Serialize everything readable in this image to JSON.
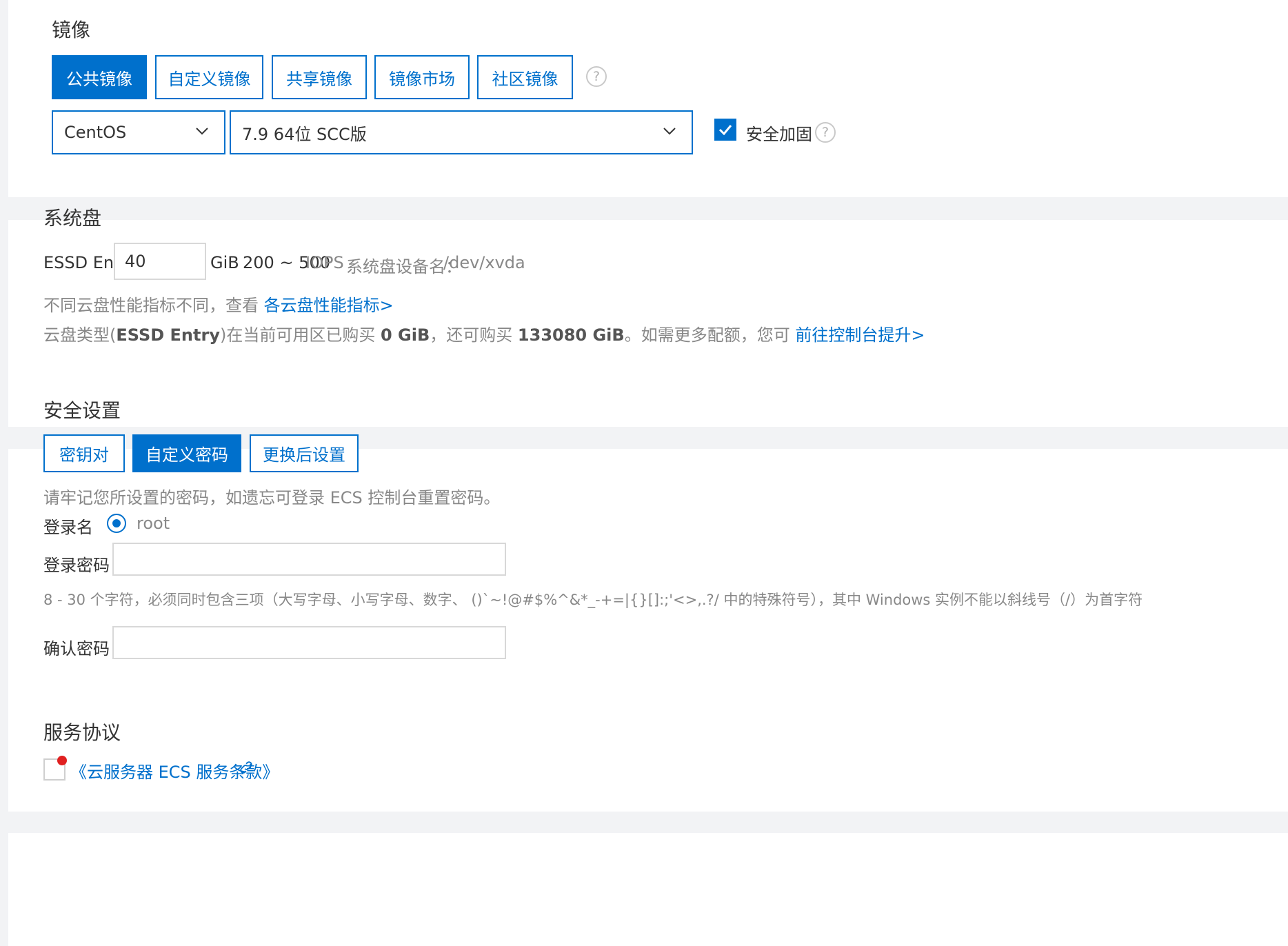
{
  "image_section": {
    "title": "镜像",
    "tabs": [
      "公共镜像",
      "自定义镜像",
      "共享镜像",
      "镜像市场",
      "社区镜像"
    ],
    "active_tab": "公共镜像",
    "os_select": "CentOS",
    "version_select": "7.9 64位 SCC版",
    "security_hardening_label": "安全加固",
    "security_hardening_checked": true
  },
  "disk_section": {
    "title": "系统盘",
    "disk_type": "ESSD Entry",
    "size_value": "40",
    "unit": "GiB",
    "iops_range": "200 ~ 500",
    "iops_label": "IOPS",
    "device_label": "系统盘设备名：",
    "device_name": "/dev/xvda",
    "perf_note": "不同云盘性能指标不同，查看",
    "perf_link": "各云盘性能指标>",
    "quota_prefix": "云盘类型(",
    "quota_type": "ESSD Entry",
    "quota_mid1": ")在当前可用区已购买",
    "quota_bought": "0 GiB",
    "quota_mid2": "，还可购买",
    "quota_available": "133080 GiB",
    "quota_mid3": "。如需更多配额，您可",
    "quota_link": "前往控制台提升>"
  },
  "security_section": {
    "title": "安全设置",
    "tabs": [
      "密钥对",
      "自定义密码",
      "更换后设置"
    ],
    "active_tab": "自定义密码",
    "reminder": "请牢记您所设置的密码，如遗忘可登录 ECS 控制台重置密码。",
    "login_name_label": "登录名",
    "login_name_value": "root",
    "password_label": "登录密码",
    "password_hint": "8 - 30 个字符，必须同时包含三项（大写字母、小写字母、数字、 ()`~!@#$%^&*_-+=|{}[]:;'<>,.?/ 中的特殊符号），其中 Windows 实例不能以斜线号（/）为首字符",
    "confirm_label": "确认密码"
  },
  "service_section": {
    "title": "服务协议",
    "agreement_link": "《云服务器 ECS 服务条款》",
    "agreement_checked": false
  },
  "colors": {
    "accent": "#0070cc",
    "background": "#f2f3f5",
    "required_dot": "#e02020"
  }
}
